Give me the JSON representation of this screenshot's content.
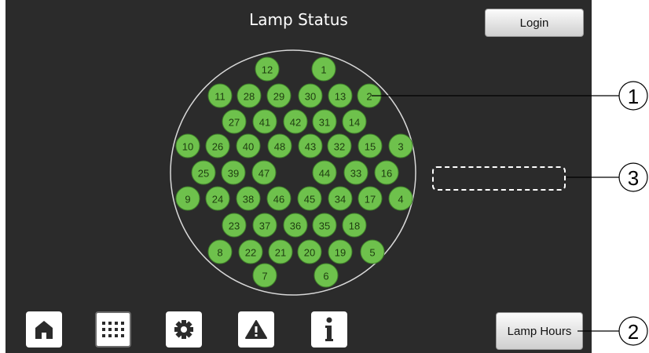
{
  "screen": {
    "title": "Lamp Status",
    "login_label": "Login",
    "lamp_hours_label": "Lamp Hours"
  },
  "lamps": {
    "color": "#6ec14c",
    "border_color": "#3f7f2a",
    "items": [
      {
        "n": "1"
      },
      {
        "n": "2"
      },
      {
        "n": "3"
      },
      {
        "n": "4"
      },
      {
        "n": "5"
      },
      {
        "n": "6"
      },
      {
        "n": "7"
      },
      {
        "n": "8"
      },
      {
        "n": "9"
      },
      {
        "n": "10"
      },
      {
        "n": "11"
      },
      {
        "n": "12"
      },
      {
        "n": "13"
      },
      {
        "n": "14"
      },
      {
        "n": "15"
      },
      {
        "n": "16"
      },
      {
        "n": "17"
      },
      {
        "n": "18"
      },
      {
        "n": "19"
      },
      {
        "n": "20"
      },
      {
        "n": "21"
      },
      {
        "n": "22"
      },
      {
        "n": "23"
      },
      {
        "n": "24"
      },
      {
        "n": "25"
      },
      {
        "n": "26"
      },
      {
        "n": "27"
      },
      {
        "n": "28"
      },
      {
        "n": "29"
      },
      {
        "n": "30"
      },
      {
        "n": "31"
      },
      {
        "n": "32"
      },
      {
        "n": "33"
      },
      {
        "n": "34"
      },
      {
        "n": "35"
      },
      {
        "n": "36"
      },
      {
        "n": "37"
      },
      {
        "n": "38"
      },
      {
        "n": "39"
      },
      {
        "n": "40"
      },
      {
        "n": "41"
      },
      {
        "n": "42"
      },
      {
        "n": "43"
      },
      {
        "n": "44"
      },
      {
        "n": "45"
      },
      {
        "n": "46"
      },
      {
        "n": "47"
      },
      {
        "n": "48"
      }
    ]
  },
  "nav": [
    {
      "name": "home",
      "icon": "home-icon"
    },
    {
      "name": "lamp-grid",
      "icon": "grid-icon"
    },
    {
      "name": "settings",
      "icon": "gear-icon"
    },
    {
      "name": "warnings",
      "icon": "warning-icon"
    },
    {
      "name": "info",
      "icon": "info-icon"
    }
  ],
  "callouts": [
    "1",
    "2",
    "3"
  ]
}
